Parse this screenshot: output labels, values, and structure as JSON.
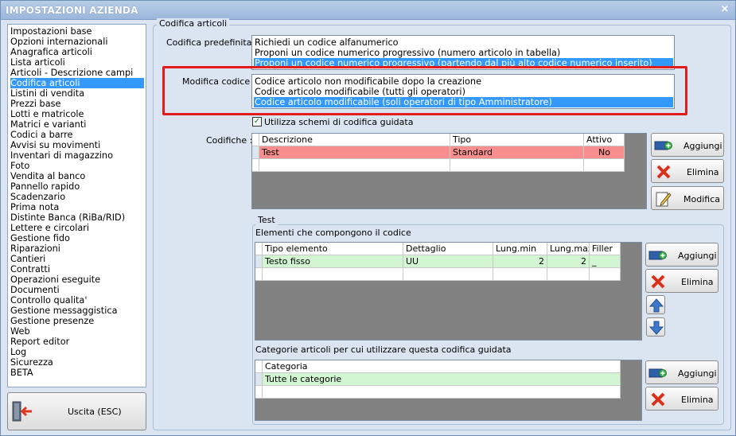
{
  "window": {
    "title": "IMPOSTAZIONI AZIENDA",
    "close": "×"
  },
  "sidebar": {
    "items": [
      {
        "label": "Impostazioni base"
      },
      {
        "label": "Opzioni internazionali"
      },
      {
        "label": "Anagrafica articoli"
      },
      {
        "label": "Lista articoli"
      },
      {
        "label": "Articoli - Descrizione campi"
      },
      {
        "label": "Codifica articoli",
        "selected": true
      },
      {
        "label": "Listini di vendita"
      },
      {
        "label": "Prezzi base"
      },
      {
        "label": "Lotti e matricole"
      },
      {
        "label": "Matrici e varianti"
      },
      {
        "label": "Codici a barre"
      },
      {
        "label": "Avvisi su movimenti"
      },
      {
        "label": "Inventari di magazzino"
      },
      {
        "label": "Foto"
      },
      {
        "label": "Vendita al banco"
      },
      {
        "label": "Pannello rapido"
      },
      {
        "label": "Scadenzario"
      },
      {
        "label": "Prima nota"
      },
      {
        "label": "Distinte Banca (RiBa/RID)"
      },
      {
        "label": "Lettere e circolari"
      },
      {
        "label": "Gestione fido"
      },
      {
        "label": "Riparazioni"
      },
      {
        "label": "Cantieri"
      },
      {
        "label": "Contratti"
      },
      {
        "label": "Operazioni eseguite"
      },
      {
        "label": "Documenti"
      },
      {
        "label": "Controllo qualita'"
      },
      {
        "label": "Gestione messaggistica"
      },
      {
        "label": "Gestione presenze"
      },
      {
        "label": "Web"
      },
      {
        "label": "Report editor"
      },
      {
        "label": "Log"
      },
      {
        "label": "Sicurezza"
      },
      {
        "label": "BETA"
      }
    ],
    "exit_label": "Uscita (ESC)"
  },
  "main": {
    "group_label": "Codifica articoli",
    "codifica_predefinita": {
      "label": "Codifica predefinita :",
      "options": [
        "Richiedi un codice alfanumerico",
        "Proponi un codice numerico progressivo (numero articolo in tabella)",
        "Proponi un codice numerico progressivo (partendo dal più alto codice numerico inserito)"
      ],
      "selected_index": 2
    },
    "modifica_codice": {
      "label": "Modifica codice :",
      "options": [
        "Codice articolo non modificabile dopo la creazione",
        "Codice articolo modificabile (tutti gli operatori)",
        "Codice articolo modificabile (soli operatori di tipo Amministratore)"
      ],
      "selected_index": 2
    },
    "checkbox": {
      "label": "Utilizza schemi di codifica guidata",
      "checked": true
    },
    "codifiche": {
      "label": "Codifiche :",
      "columns": [
        "Descrizione",
        "Tipo",
        "Attivo"
      ],
      "rows": [
        [
          "Test",
          "Standard",
          "No"
        ]
      ],
      "buttons": {
        "add": "Aggiungi",
        "delete": "Elimina",
        "edit": "Modifica"
      }
    },
    "test_group": {
      "label": "Test",
      "elements_label": "Elementi che compongono il codice",
      "columns": [
        "Tipo elemento",
        "Dettaglio",
        "Lung.min",
        "Lung.max",
        "Filler"
      ],
      "rows": [
        [
          "Testo fisso",
          "UU",
          "2",
          "2",
          "_"
        ]
      ],
      "buttons": {
        "add": "Aggiungi",
        "delete": "Elimina"
      },
      "categories_label": "Categorie articoli per cui utilizzare questa codifica guidata",
      "categories_columns": [
        "Categoria"
      ],
      "categories_rows": [
        [
          "Tutte le categorie"
        ]
      ],
      "categories_buttons": {
        "add": "Aggiungi",
        "delete": "Elimina"
      }
    }
  },
  "colors": {
    "selection": "#3399ff",
    "highlight_row_red": "#f98e8e",
    "highlight_row_green": "#d2f5d2",
    "annotation_red": "#e21c1c",
    "window_bg": "#dbe5f1"
  }
}
